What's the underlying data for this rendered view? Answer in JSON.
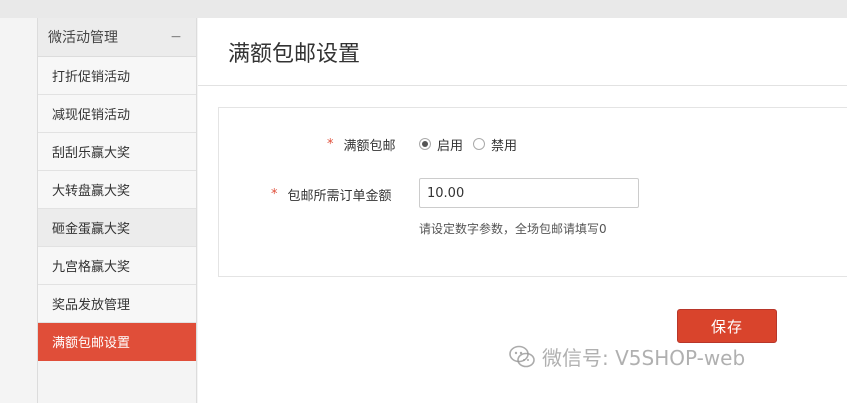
{
  "sidebar": {
    "group_title": "微活动管理",
    "collapse_symbol": "−",
    "items": [
      {
        "label": "打折促销活动"
      },
      {
        "label": "减现促销活动"
      },
      {
        "label": "刮刮乐赢大奖"
      },
      {
        "label": "大转盘赢大奖"
      },
      {
        "label": "砸金蛋赢大奖"
      },
      {
        "label": "九宫格赢大奖"
      },
      {
        "label": "奖品发放管理"
      },
      {
        "label": "满额包邮设置"
      }
    ],
    "active_index": 7
  },
  "main": {
    "title": "满额包邮设置",
    "form": {
      "required_mark": "*",
      "free_shipping_label": "满额包邮",
      "options": [
        {
          "label": "启用",
          "checked": true
        },
        {
          "label": "禁用",
          "checked": false
        }
      ],
      "amount_label": "包邮所需订单金额",
      "amount_value": "10.00",
      "hint": "请设定数字参数，全场包邮请填写0"
    },
    "save_label": "保存"
  },
  "watermark": {
    "text": "微信号: V5SHOP-web",
    "icon": "wechat-icon"
  },
  "colors": {
    "accent": "#e04e39",
    "button": "#d9442c"
  }
}
